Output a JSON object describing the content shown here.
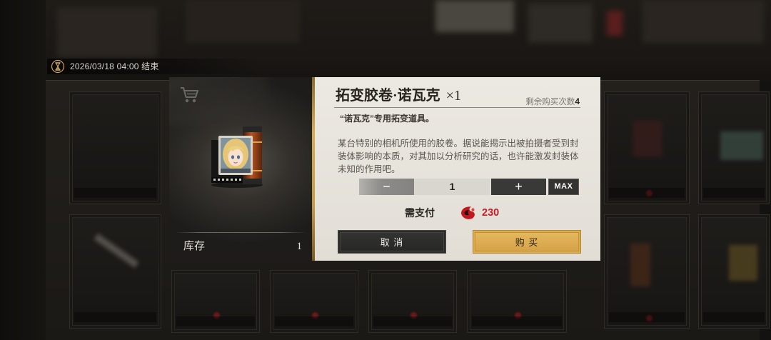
{
  "event_timer": {
    "icon": "hourglass-icon",
    "text": "2026/03/18 04:00 结束"
  },
  "item_panel": {
    "cart_icon": "shopping-cart-icon",
    "item_image": "film-roll-portrait",
    "stock_label": "库存",
    "stock_value": "1"
  },
  "purchase": {
    "item_name": "拓变胶卷·诺瓦克",
    "quantity_badge": "×1",
    "remaining_label": "剩余购买次数",
    "remaining_value": "4",
    "subtitle": "“诺瓦克”专用拓变道具。",
    "description_lines": [
      "某台特别的相机所使用的胶卷。据说能揭示出被拍摄者受到封",
      "装体影响的本质，对其加以分析研究的话，也许能激发封装体",
      "未知的作用吧。"
    ],
    "stepper": {
      "minus": "−",
      "value": "1",
      "plus": "+",
      "max": "MAX"
    },
    "cost_label": "需支付",
    "cost_icon": "red-mask-currency-icon",
    "cost_value": "230",
    "cancel_label": "取 消",
    "buy_label": "购 买"
  },
  "colors": {
    "accent_gold": "#d8a84a",
    "cost_red": "#c41e2a",
    "panel_bg": "#e8e4dc",
    "button_dark": "#2c2c2c"
  }
}
